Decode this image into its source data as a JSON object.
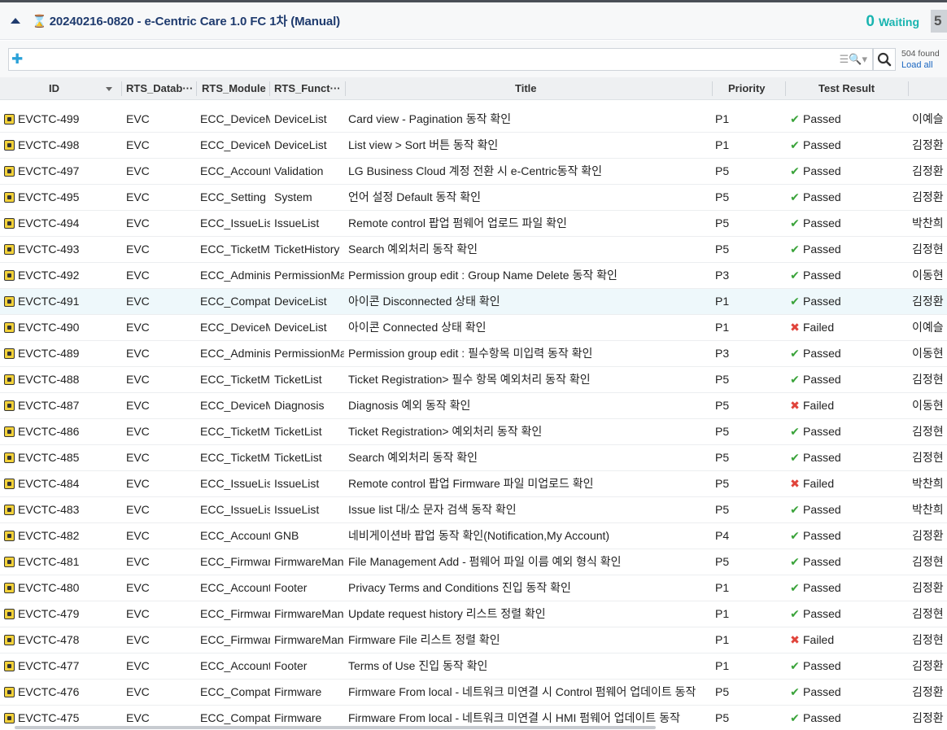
{
  "header": {
    "run_title": "20240216-0820 - e-Centric Care 1.0 FC 1차 (Manual)",
    "waiting_count": "0",
    "waiting_label": "Waiting",
    "count_box": "5"
  },
  "search": {
    "placeholder": "",
    "found": "504 found",
    "load_all": "Load all"
  },
  "columns": {
    "id": "ID",
    "database": "RTS_Datab···",
    "module": "RTS_Module",
    "function": "RTS_Funct···",
    "title": "Title",
    "priority": "Priority",
    "result": "Test Result"
  },
  "colors": {
    "accent": "#1f3b6e",
    "waiting": "#19b4b0",
    "pass": "#3aa33a",
    "fail": "#e0433a",
    "link": "#1a66c0"
  },
  "rows": [
    {
      "id": "EVCTC-499",
      "db": "EVC",
      "module": "ECC_DeviceMa",
      "func": "DeviceList",
      "title": "Card view - Pagination 동작 확인",
      "priority": "P1",
      "result": "Passed",
      "owner": "이예슬"
    },
    {
      "id": "EVCTC-498",
      "db": "EVC",
      "module": "ECC_DeviceMa",
      "func": "DeviceList",
      "title": "List view > Sort 버튼 동작 확인",
      "priority": "P1",
      "result": "Passed",
      "owner": "김정환"
    },
    {
      "id": "EVCTC-497",
      "db": "EVC",
      "module": "ECC_AccountI",
      "func": "Validation",
      "title": "LG Business Cloud 계정 전환 시 e-Centric동작 확인",
      "priority": "P5",
      "result": "Passed",
      "owner": "김정환"
    },
    {
      "id": "EVCTC-495",
      "db": "EVC",
      "module": "ECC_Setting",
      "func": "System",
      "title": "언어 설정 Default 동작 확인",
      "priority": "P5",
      "result": "Passed",
      "owner": "김정환"
    },
    {
      "id": "EVCTC-494",
      "db": "EVC",
      "module": "ECC_IssueList",
      "func": "IssueList",
      "title": "Remote control 팝업 펌웨어 업로드 파일 확인",
      "priority": "P5",
      "result": "Passed",
      "owner": "박찬희"
    },
    {
      "id": "EVCTC-493",
      "db": "EVC",
      "module": "ECC_TicketMa",
      "func": "TicketHistory",
      "title": "Search 예외처리 동작 확인",
      "priority": "P5",
      "result": "Passed",
      "owner": "김정현"
    },
    {
      "id": "EVCTC-492",
      "db": "EVC",
      "module": "ECC_Administ",
      "func": "PermissionMa",
      "title": "Permission group edit : Group Name Delete 동작 확인",
      "priority": "P3",
      "result": "Passed",
      "owner": "이동현"
    },
    {
      "id": "EVCTC-491",
      "db": "EVC",
      "module": "ECC_Compati",
      "func": "DeviceList",
      "title": "아이콘 Disconnected 상태 확인",
      "priority": "P1",
      "result": "Passed",
      "owner": "김정환",
      "highlight": true
    },
    {
      "id": "EVCTC-490",
      "db": "EVC",
      "module": "ECC_DeviceMa",
      "func": "DeviceList",
      "title": "아이콘 Connected 상태 확인",
      "priority": "P1",
      "result": "Failed",
      "owner": "이예슬"
    },
    {
      "id": "EVCTC-489",
      "db": "EVC",
      "module": "ECC_Administ",
      "func": "PermissionMa",
      "title": "Permission group edit : 필수항목 미입력 동작 확인",
      "priority": "P3",
      "result": "Passed",
      "owner": "이동현"
    },
    {
      "id": "EVCTC-488",
      "db": "EVC",
      "module": "ECC_TicketMa",
      "func": "TicketList",
      "title": "Ticket Registration> 필수 항목 예외처리 동작 확인",
      "priority": "P5",
      "result": "Passed",
      "owner": "김정현"
    },
    {
      "id": "EVCTC-487",
      "db": "EVC",
      "module": "ECC_DeviceMa",
      "func": "Diagnosis",
      "title": "Diagnosis 예외 동작 확인",
      "priority": "P5",
      "result": "Failed",
      "owner": "이동현"
    },
    {
      "id": "EVCTC-486",
      "db": "EVC",
      "module": "ECC_TicketMa",
      "func": "TicketList",
      "title": "Ticket Registration> 예외처리 동작 확인",
      "priority": "P5",
      "result": "Passed",
      "owner": "김정현"
    },
    {
      "id": "EVCTC-485",
      "db": "EVC",
      "module": "ECC_TicketMa",
      "func": "TicketList",
      "title": "Search 예외처리 동작 확인",
      "priority": "P5",
      "result": "Passed",
      "owner": "김정현"
    },
    {
      "id": "EVCTC-484",
      "db": "EVC",
      "module": "ECC_IssueList",
      "func": "IssueList",
      "title": "Remote control 팝업 Firmware 파일 미업로드 확인",
      "priority": "P5",
      "result": "Failed",
      "owner": "박찬희"
    },
    {
      "id": "EVCTC-483",
      "db": "EVC",
      "module": "ECC_IssueList",
      "func": "IssueList",
      "title": "Issue list 대/소 문자 검색 동작 확인",
      "priority": "P5",
      "result": "Passed",
      "owner": "박찬희"
    },
    {
      "id": "EVCTC-482",
      "db": "EVC",
      "module": "ECC_AccountI",
      "func": "GNB",
      "title": "네비게이션바 팝업 동작 확인(Notification,My Account)",
      "priority": "P4",
      "result": "Passed",
      "owner": "김정환"
    },
    {
      "id": "EVCTC-481",
      "db": "EVC",
      "module": "ECC_Firmware",
      "func": "FirmwareMan",
      "title": "File Management Add - 펌웨어 파일 이름 예외 형식 확인",
      "priority": "P5",
      "result": "Passed",
      "owner": "김정현"
    },
    {
      "id": "EVCTC-480",
      "db": "EVC",
      "module": "ECC_AccountI",
      "func": "Footer",
      "title": "Privacy Terms and Conditions 진입 동작 확인",
      "priority": "P1",
      "result": "Passed",
      "owner": "김정환"
    },
    {
      "id": "EVCTC-479",
      "db": "EVC",
      "module": "ECC_Firmware",
      "func": "FirmwareMan",
      "title": "Update request history 리스트 정렬 확인",
      "priority": "P1",
      "result": "Passed",
      "owner": "김정현"
    },
    {
      "id": "EVCTC-478",
      "db": "EVC",
      "module": "ECC_Firmware",
      "func": "FirmwareMan",
      "title": "Firmware File 리스트 정렬 확인",
      "priority": "P1",
      "result": "Failed",
      "owner": "김정현"
    },
    {
      "id": "EVCTC-477",
      "db": "EVC",
      "module": "ECC_AccountI",
      "func": "Footer",
      "title": "Terms of Use 진입 동작 확인",
      "priority": "P1",
      "result": "Passed",
      "owner": "김정환"
    },
    {
      "id": "EVCTC-476",
      "db": "EVC",
      "module": "ECC_Compati",
      "func": "Firmware",
      "title": "Firmware From local - 네트워크 미연결 시 Control 펌웨어 업데이트 동작",
      "priority": "P5",
      "result": "Passed",
      "owner": "김정환"
    },
    {
      "id": "EVCTC-475",
      "db": "EVC",
      "module": "ECC_Compati",
      "func": "Firmware",
      "title": "Firmware From local - 네트워크 미연결 시 HMI 펌웨어 업데이트 동작",
      "priority": "P5",
      "result": "Passed",
      "owner": "김정환"
    }
  ]
}
